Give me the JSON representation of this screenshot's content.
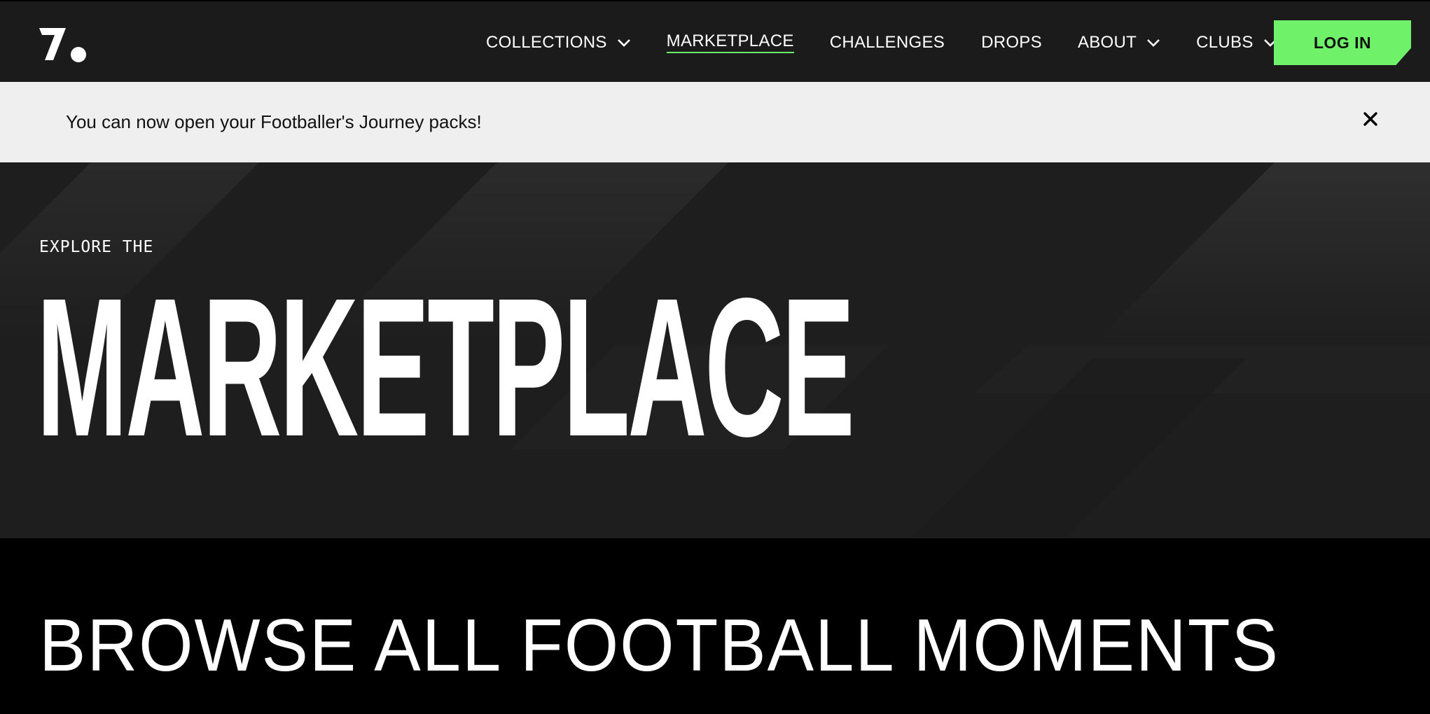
{
  "nav": {
    "logo_icon": "onefootball-logo-icon",
    "items": [
      {
        "label": "COLLECTIONS",
        "dropdown": true,
        "active": false
      },
      {
        "label": "MARKETPLACE",
        "dropdown": false,
        "active": true
      },
      {
        "label": "CHALLENGES",
        "dropdown": false,
        "active": false
      },
      {
        "label": "DROPS",
        "dropdown": false,
        "active": false
      },
      {
        "label": "ABOUT",
        "dropdown": true,
        "active": false
      },
      {
        "label": "CLUBS",
        "dropdown": true,
        "active": false
      }
    ],
    "login_label": "LOG IN"
  },
  "banner": {
    "message": "You can now open your Footballer's Journey packs!",
    "close_icon": "close-icon"
  },
  "hero": {
    "kicker": "EXPLORE THE",
    "title": "MARKETPLACE"
  },
  "browse": {
    "title": "BROWSE ALL FOOTBALL MOMENTS"
  },
  "colors": {
    "nav_bg": "#1b1b1b",
    "accent_green": "#6ff26a",
    "banner_bg": "#efefef",
    "hero_bg": "#1e1e1e",
    "page_bg": "#000000"
  }
}
